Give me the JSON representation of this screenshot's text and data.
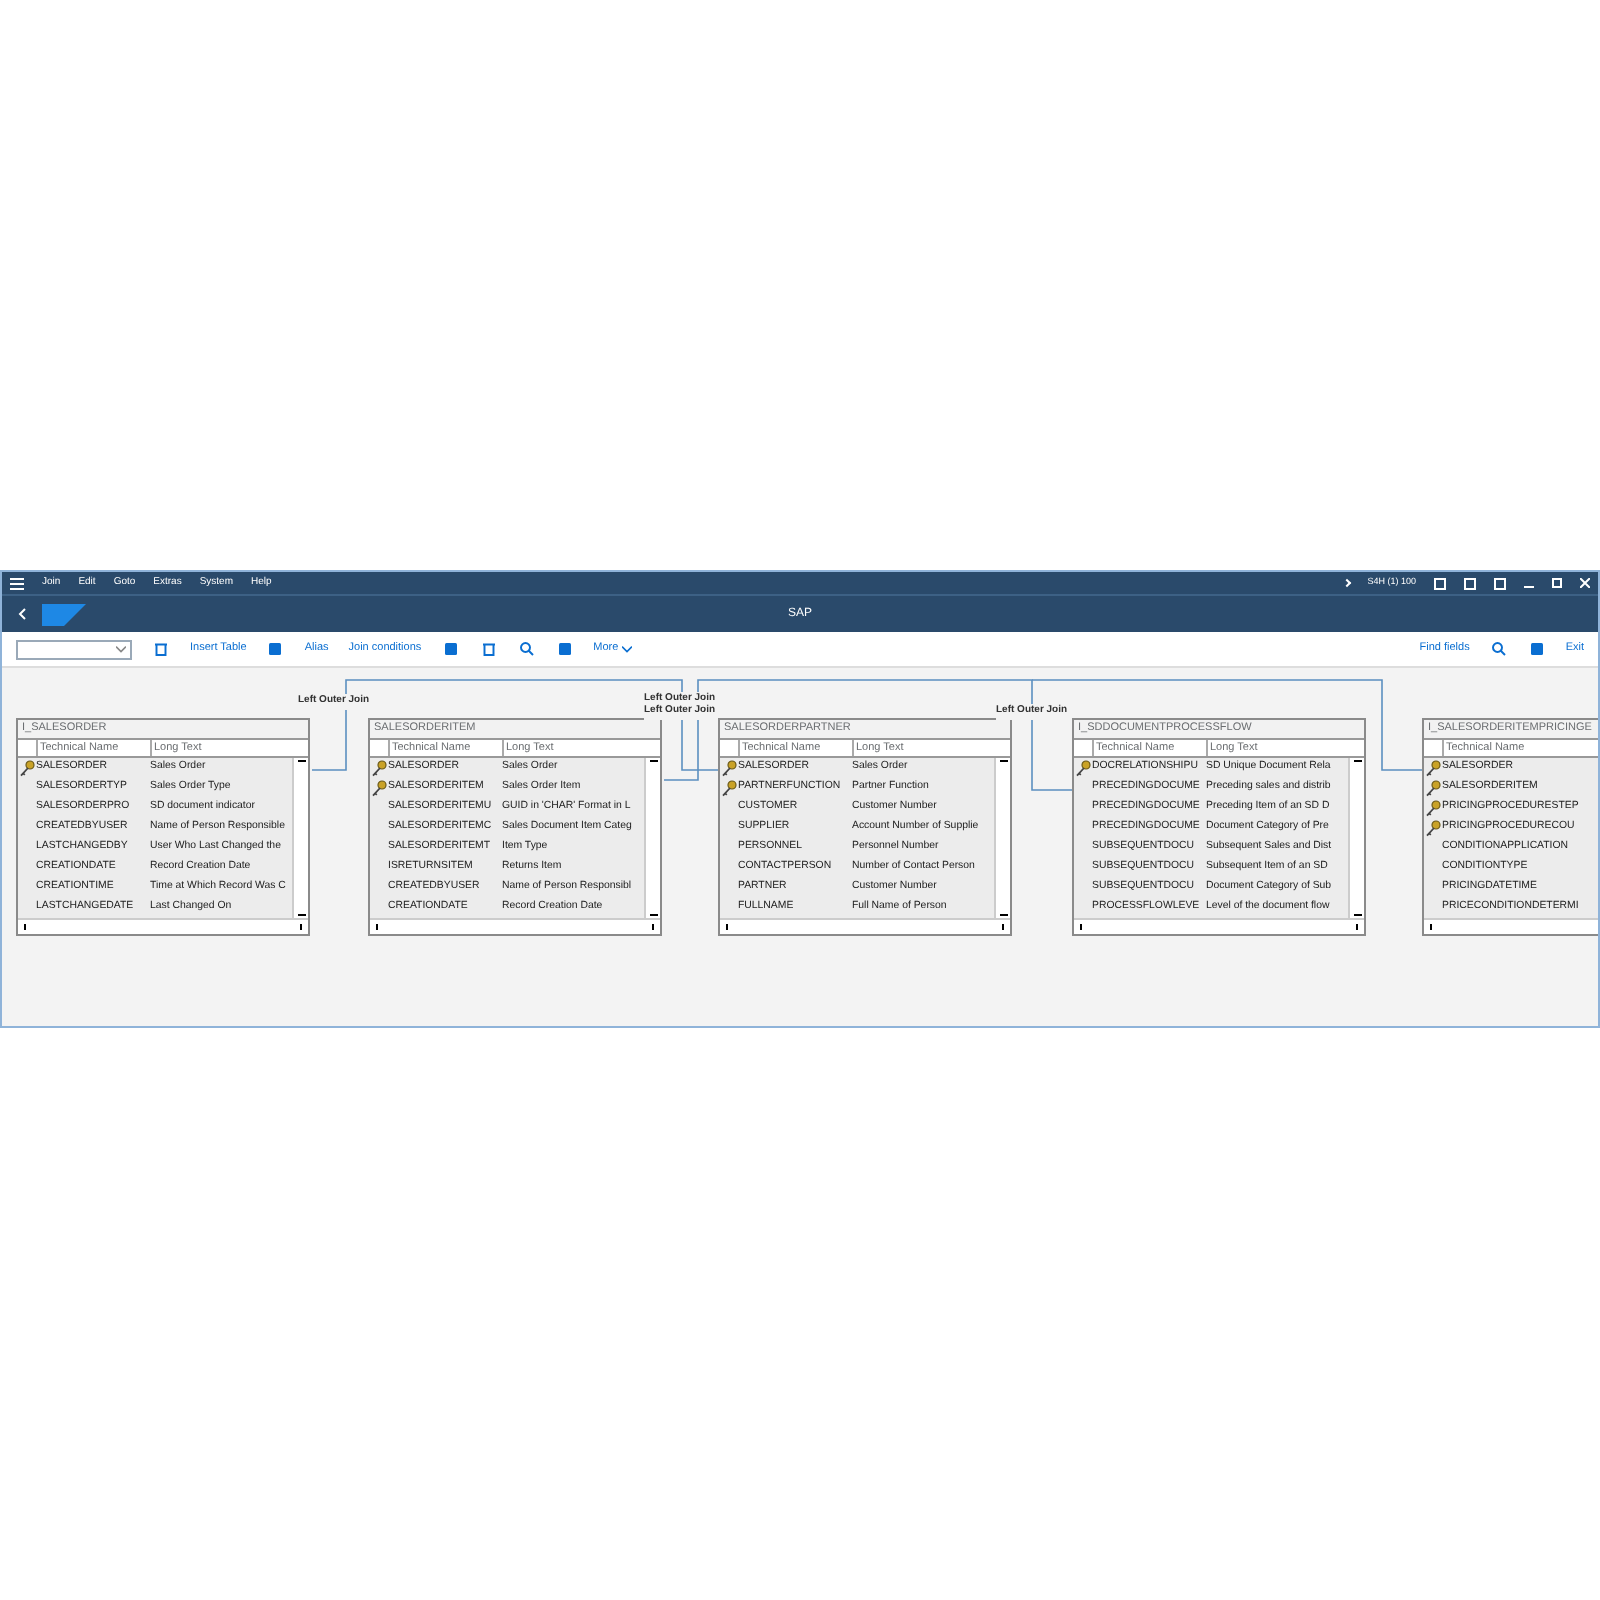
{
  "menu": [
    "Join",
    "Edit",
    "Goto",
    "Extras",
    "System",
    "Help"
  ],
  "system_info": "S4H (1) 100",
  "title": "SAP",
  "toolbar": {
    "left": [
      {
        "kind": "dropdown"
      },
      {
        "kind": "icon"
      },
      {
        "kind": "button",
        "label": "Insert Table"
      },
      {
        "kind": "icon"
      },
      {
        "kind": "button",
        "label": "Alias"
      },
      {
        "kind": "button",
        "label": "Join conditions"
      },
      {
        "kind": "icon"
      },
      {
        "kind": "icon"
      },
      {
        "kind": "icon"
      },
      {
        "kind": "icon"
      },
      {
        "kind": "more",
        "label": "More"
      }
    ],
    "right": [
      {
        "kind": "button",
        "label": "Find fields"
      },
      {
        "kind": "icon"
      },
      {
        "kind": "icon"
      },
      {
        "kind": "button",
        "label": "Exit"
      }
    ]
  },
  "tables": [
    {
      "name": "I_SALESORDER",
      "columns": [
        "Technical Name",
        "Long Text"
      ],
      "rows": [
        {
          "key": true,
          "field": "SALESORDER",
          "text": "Sales Order"
        },
        {
          "key": false,
          "field": "SALESORDERTYP",
          "text": "Sales Order Type"
        },
        {
          "key": false,
          "field": "SALESORDERPRO",
          "text": "SD document indicator"
        },
        {
          "key": false,
          "field": "CREATEDBYUSER",
          "text": "Name of Person Responsible"
        },
        {
          "key": false,
          "field": "LASTCHANGEDBY",
          "text": "User Who Last Changed the"
        },
        {
          "key": false,
          "field": "CREATIONDATE",
          "text": "Record Creation Date"
        },
        {
          "key": false,
          "field": "CREATIONTIME",
          "text": "Time at Which Record Was C"
        },
        {
          "key": false,
          "field": "LASTCHANGEDATE",
          "text": "Last Changed On"
        }
      ]
    },
    {
      "name": "SALESORDERITEM",
      "columns": [
        "Technical Name",
        "Long Text"
      ],
      "rows": [
        {
          "key": true,
          "field": "SALESORDER",
          "text": "Sales Order"
        },
        {
          "key": true,
          "field": "SALESORDERITEM",
          "text": "Sales Order Item"
        },
        {
          "key": false,
          "field": "SALESORDERITEMU",
          "text": "GUID in 'CHAR' Format in L"
        },
        {
          "key": false,
          "field": "SALESORDERITEMC",
          "text": "Sales Document Item Categ"
        },
        {
          "key": false,
          "field": "SALESORDERITEMT",
          "text": "Item Type"
        },
        {
          "key": false,
          "field": "ISRETURNSITEM",
          "text": "Returns Item"
        },
        {
          "key": false,
          "field": "CREATEDBYUSER",
          "text": "Name of Person Responsibl"
        },
        {
          "key": false,
          "field": "CREATIONDATE",
          "text": "Record Creation Date"
        }
      ]
    },
    {
      "name": "SALESORDERPARTNER",
      "columns": [
        "Technical Name",
        "Long Text"
      ],
      "rows": [
        {
          "key": true,
          "field": "SALESORDER",
          "text": "Sales Order"
        },
        {
          "key": true,
          "field": "PARTNERFUNCTION",
          "text": "Partner Function"
        },
        {
          "key": false,
          "field": "CUSTOMER",
          "text": "Customer Number"
        },
        {
          "key": false,
          "field": "SUPPLIER",
          "text": "Account Number of Supplie"
        },
        {
          "key": false,
          "field": "PERSONNEL",
          "text": "Personnel Number"
        },
        {
          "key": false,
          "field": "CONTACTPERSON",
          "text": "Number of Contact Person"
        },
        {
          "key": false,
          "field": "PARTNER",
          "text": "Customer Number"
        },
        {
          "key": false,
          "field": "FULLNAME",
          "text": "Full Name of Person"
        }
      ]
    },
    {
      "name": "I_SDDOCUMENTPROCESSFLOW",
      "columns": [
        "Technical Name",
        "Long Text"
      ],
      "rows": [
        {
          "key": true,
          "field": "DOCRELATIONSHIPU",
          "text": "SD Unique Document Rela"
        },
        {
          "key": false,
          "field": "PRECEDINGDOCUME",
          "text": "Preceding sales and distrib"
        },
        {
          "key": false,
          "field": "PRECEDINGDOCUME",
          "text": "Preceding Item of an SD D"
        },
        {
          "key": false,
          "field": "PRECEDINGDOCUME",
          "text": "Document Category of Pre"
        },
        {
          "key": false,
          "field": "SUBSEQUENTDOCU",
          "text": "Subsequent Sales and Dist"
        },
        {
          "key": false,
          "field": "SUBSEQUENTDOCU",
          "text": "Subsequent Item of an SD"
        },
        {
          "key": false,
          "field": "SUBSEQUENTDOCU",
          "text": "Document Category of Sub"
        },
        {
          "key": false,
          "field": "PROCESSFLOWLEVE",
          "text": "Level of the document flow"
        }
      ]
    },
    {
      "name": "I_SALESORDERITEMPRICINGE",
      "columns": [
        "Technical Name"
      ],
      "rows": [
        {
          "key": true,
          "field": "SALESORDER"
        },
        {
          "key": true,
          "field": "SALESORDERITEM"
        },
        {
          "key": true,
          "field": "PRICINGPROCEDURESTEP"
        },
        {
          "key": true,
          "field": "PRICINGPROCEDURECOU"
        },
        {
          "key": false,
          "field": "CONDITIONAPPLICATION"
        },
        {
          "key": false,
          "field": "CONDITIONTYPE"
        },
        {
          "key": false,
          "field": "PRICINGDATETIME"
        },
        {
          "key": false,
          "field": "PRICECONDITIONDETERMI"
        }
      ]
    }
  ],
  "joins": [
    "Left Outer Join",
    "Left Outer Join",
    "Left Outer Join",
    "Left Outer Join"
  ]
}
